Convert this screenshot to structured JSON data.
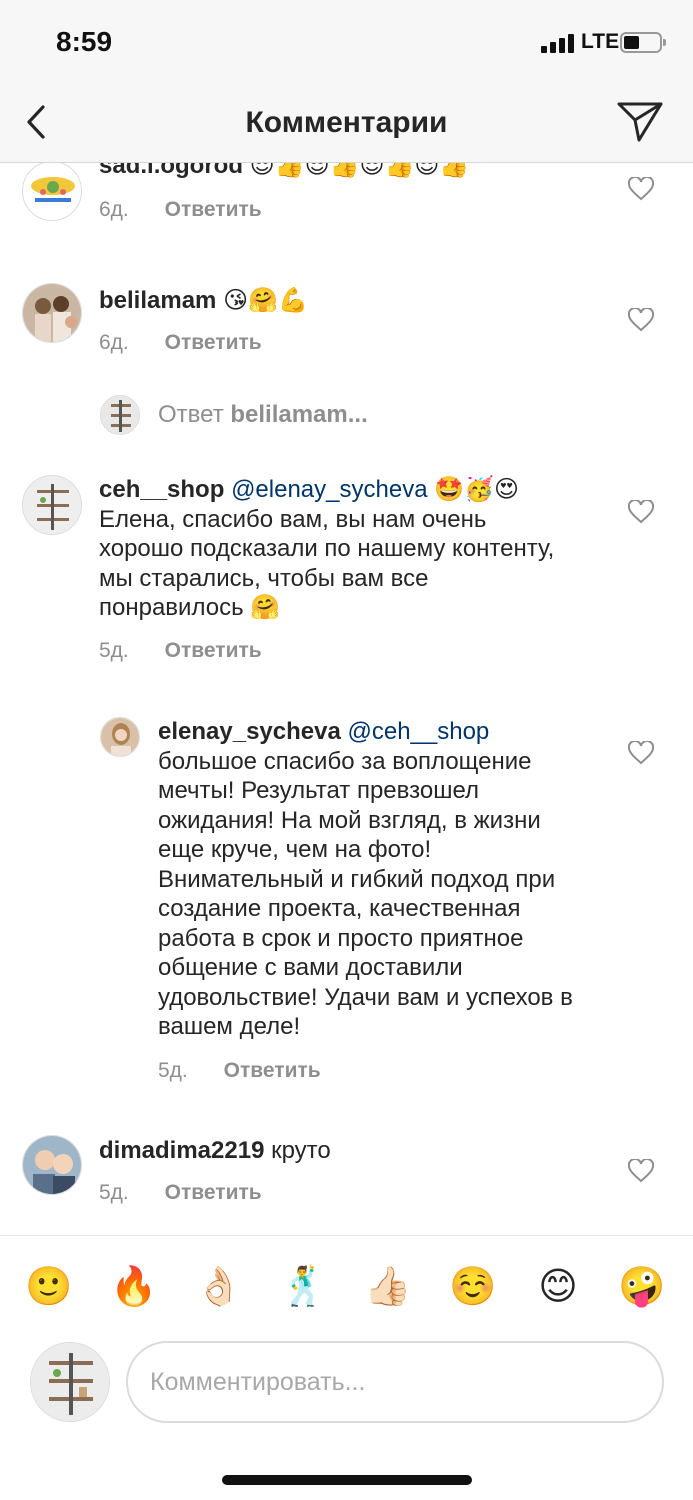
{
  "status": {
    "time": "8:59",
    "network": "LTE"
  },
  "header": {
    "title": "Комментарии",
    "back_icon": "chevron-left-icon",
    "send_icon": "paper-plane-icon"
  },
  "comments": [
    {
      "username": "sad.i.ogorod",
      "text": "😎👍😎👍😎👍😎👍",
      "age": "6д.",
      "reply_label": "Ответить"
    },
    {
      "username": "belilamam",
      "text": "😘🤗💪",
      "age": "6д.",
      "reply_label": "Ответить",
      "view_replies": {
        "label": "Ответ",
        "user": "belilamam..."
      }
    },
    {
      "username": "ceh__shop",
      "mention": "@elenay_sycheva",
      "emojis": "🤩🥳😍",
      "text": "Елена, спасибо вам, вы нам очень хорошо подсказали по нашему контенту, мы старались, чтобы вам все понравилось",
      "text_emoji": "🤗",
      "age": "5д.",
      "reply_label": "Ответить"
    },
    {
      "username": "elenay_sycheva",
      "mention": "@ceh__shop",
      "text": "большое спасибо за воплощение мечты! Результат превзошел ожидания! На мой взгляд, в жизни еще круче, чем на фото! Внимательный и гибкий подход при создание проекта, качественная работа в срок и просто приятное общение с вами доставили удовольствие! Удачи вам и успехов в вашем деле!",
      "age": "5д.",
      "reply_label": "Ответить"
    },
    {
      "username": "dimadima2219",
      "text": "круто",
      "age": "5д.",
      "reply_label": "Ответить"
    }
  ],
  "quick_emojis": [
    "🙂",
    "🔥",
    "👌🏻",
    "🕺",
    "👍🏻",
    "☺️",
    "😊",
    "🤪"
  ],
  "composer": {
    "placeholder": "Комментировать..."
  },
  "colors": {
    "mention": "#003569",
    "muted": "#8e8e8e",
    "text": "#262626"
  }
}
